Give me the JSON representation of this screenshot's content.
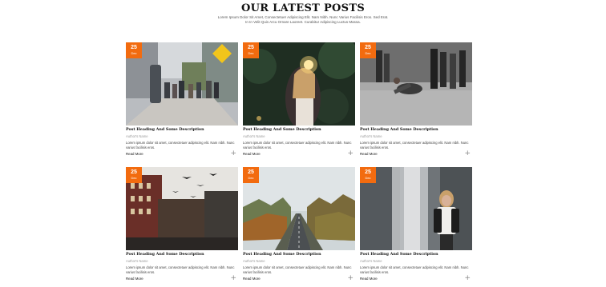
{
  "section": {
    "title": "OUR LATEST POSTS",
    "subtitle": "Lorem Ipsum Dolor Sit Amet, Consectetuer Adipiscing Elit. Nam Nibh. Nunc Varius Facilisis Eros. Sed Erat. In In Velit Quis Arcu Ornare Laoreet. Curabitur Adipiscing Luctus Massa."
  },
  "posts": [
    {
      "day": "25",
      "month": "Dec",
      "title": "Post Heading And Some Description",
      "author": "Author's Name",
      "excerpt": "Lorem ipsum dolor sit amet, consectetuer adipiscing elit. Nam nibh. Nunc varius facilisis eros.",
      "read_more": "Read More",
      "image": "city-street-walkers"
    },
    {
      "day": "25",
      "month": "Dec",
      "title": "Post Heading And Some Description",
      "author": "Author's Name",
      "excerpt": "Lorem ipsum dolor sit amet, consectetuer adipiscing elit. Nam nibh. Nunc varius facilisis eros.",
      "read_more": "Read More",
      "image": "woman-with-sparkler"
    },
    {
      "day": "25",
      "month": "Dec",
      "title": "Post Heading And Some Description",
      "author": "Author's Name",
      "excerpt": "Lorem ipsum dolor sit amet, consectetuer adipiscing elit. Nam nibh. Nunc varius facilisis eros.",
      "read_more": "Read More",
      "image": "street-breakdancer"
    },
    {
      "day": "25",
      "month": "Dec",
      "title": "Post Heading And Some Description",
      "author": "Author's Name",
      "excerpt": "Lorem ipsum dolor sit amet, consectetuer adipiscing elit. Nam nibh. Nunc varius facilisis eros.",
      "read_more": "Read More",
      "image": "buildings-with-birds"
    },
    {
      "day": "25",
      "month": "Dec",
      "title": "Post Heading And Some Description",
      "author": "Author's Name",
      "excerpt": "Lorem ipsum dolor sit amet, consectetuer adipiscing elit. Nam nibh. Nunc varius facilisis eros.",
      "read_more": "Read More",
      "image": "foggy-forest-road"
    },
    {
      "day": "25",
      "month": "Dec",
      "title": "Post Heading And Some Description",
      "author": "Author's Name",
      "excerpt": "Lorem ipsum dolor sit amet, consectetuer adipiscing elit. Nam nibh. Nunc varius facilisis eros.",
      "read_more": "Read More",
      "image": "woman-by-waterfall"
    }
  ],
  "colors": {
    "badge": "#f26b0f",
    "background": "#ffffff"
  }
}
